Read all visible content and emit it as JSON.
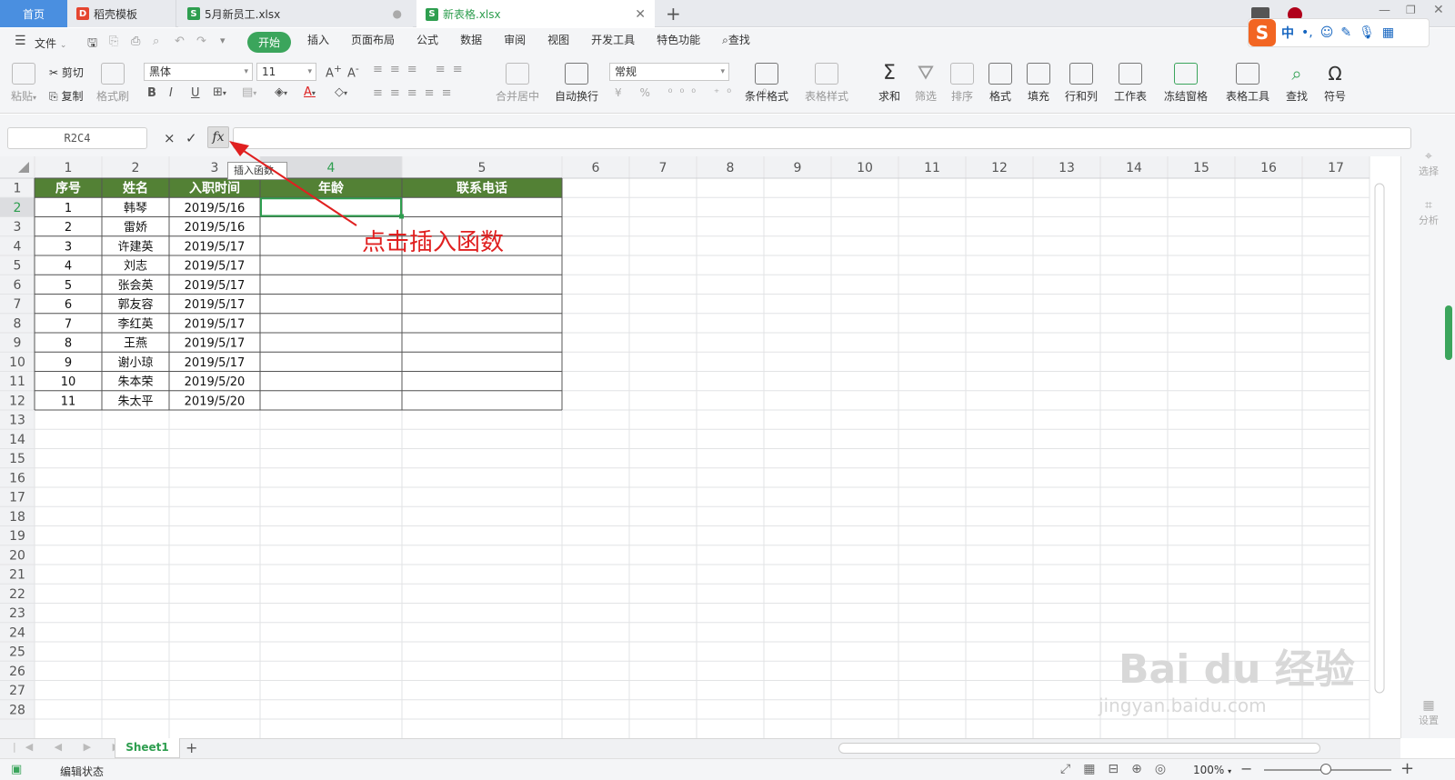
{
  "tabs": [
    {
      "label": "首页"
    },
    {
      "label": "稻壳模板"
    },
    {
      "label": "5月新员工.xlsx"
    },
    {
      "label": "新表格.xlsx"
    }
  ],
  "menu": {
    "file": "文件",
    "items": [
      "开始",
      "插入",
      "页面布局",
      "公式",
      "数据",
      "审阅",
      "视图",
      "开发工具",
      "特色功能"
    ],
    "search": "查找"
  },
  "ribbon": {
    "paste": "粘贴",
    "cut": "剪切",
    "copy": "复制",
    "format_painter": "格式刷",
    "font_name": "黑体",
    "font_size": "11",
    "merge_center": "合并居中",
    "wrap_text": "自动换行",
    "number_format": "常规",
    "conditional_format": "条件格式",
    "table_style": "表格样式",
    "sum": "求和",
    "filter": "筛选",
    "sort": "排序",
    "format": "格式",
    "fill": "填充",
    "rows_cols": "行和列",
    "worksheet": "工作表",
    "freeze": "冻结窗格",
    "table_tools": "表格工具",
    "find": "查找",
    "symbol": "符号"
  },
  "ime": {
    "lang": "中"
  },
  "formula_bar": {
    "name_box": "R2C4",
    "cancel": "×",
    "confirm": "✓",
    "fx": "fx",
    "tooltip": "插入函数"
  },
  "sheet": {
    "column_headers": [
      "1",
      "2",
      "3",
      "4",
      "5",
      "6",
      "7",
      "8",
      "9",
      "10",
      "11",
      "12",
      "13",
      "14",
      "15",
      "16",
      "17"
    ],
    "row_headers": [
      "1",
      "2",
      "3",
      "4",
      "5",
      "6",
      "7",
      "8",
      "9",
      "10",
      "11",
      "12",
      "13",
      "14",
      "15",
      "16",
      "17",
      "18",
      "19",
      "20",
      "21",
      "22",
      "23",
      "24",
      "25",
      "26",
      "27",
      "28"
    ],
    "table_header": [
      "序号",
      "姓名",
      "入职时间",
      "年龄",
      "联系电话"
    ],
    "rows": [
      [
        "1",
        "韩琴",
        "2019/5/16",
        "",
        ""
      ],
      [
        "2",
        "雷娇",
        "2019/5/16",
        "",
        ""
      ],
      [
        "3",
        "许建英",
        "2019/5/17",
        "",
        ""
      ],
      [
        "4",
        "刘志",
        "2019/5/17",
        "",
        ""
      ],
      [
        "5",
        "张会英",
        "2019/5/17",
        "",
        ""
      ],
      [
        "6",
        "郭友容",
        "2019/5/17",
        "",
        ""
      ],
      [
        "7",
        "李红英",
        "2019/5/17",
        "",
        ""
      ],
      [
        "8",
        "王燕",
        "2019/5/17",
        "",
        ""
      ],
      [
        "9",
        "谢小琼",
        "2019/5/17",
        "",
        ""
      ],
      [
        "10",
        "朱本荣",
        "2019/5/20",
        "",
        ""
      ],
      [
        "11",
        "朱太平",
        "2019/5/20",
        "",
        ""
      ]
    ],
    "header_color": "#538135",
    "active_color": "#2e9e4f"
  },
  "annotation": "点击插入函数",
  "sheet_tabs": {
    "active": "Sheet1",
    "add": "+"
  },
  "status": {
    "mode": "编辑状态",
    "zoom": "100%"
  },
  "right_panel": {
    "select": "选择",
    "analyze": "分析",
    "settings": "设置"
  },
  "watermark": {
    "brand": "Bai du 经验",
    "url": "jingyan.baidu.com"
  }
}
